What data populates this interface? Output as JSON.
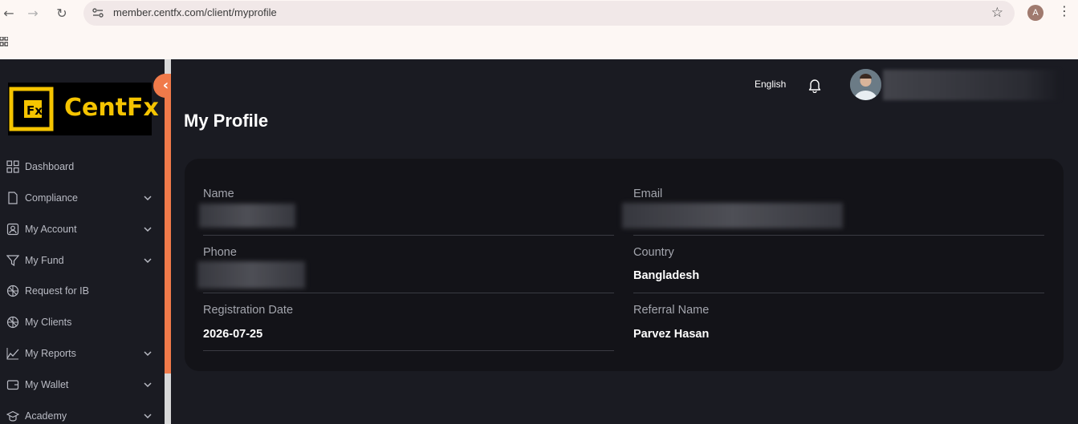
{
  "browser": {
    "url": "member.centfx.com/client/myprofile",
    "profile_initial": "A"
  },
  "sidebar": {
    "logo_text": "CentFx",
    "items": [
      {
        "label": "Dashboard",
        "icon": "dashboard-icon",
        "has_chevron": false
      },
      {
        "label": "Compliance",
        "icon": "document-icon",
        "has_chevron": true
      },
      {
        "label": "My Account",
        "icon": "account-icon",
        "has_chevron": true
      },
      {
        "label": "My Fund",
        "icon": "fund-icon",
        "has_chevron": true
      },
      {
        "label": "Request for IB",
        "icon": "ib-icon",
        "has_chevron": false
      },
      {
        "label": "My Clients",
        "icon": "clients-icon",
        "has_chevron": false
      },
      {
        "label": "My Reports",
        "icon": "reports-icon",
        "has_chevron": true
      },
      {
        "label": "My Wallet",
        "icon": "wallet-icon",
        "has_chevron": true
      },
      {
        "label": "Academy",
        "icon": "academy-icon",
        "has_chevron": true
      }
    ]
  },
  "header": {
    "language": "English"
  },
  "page": {
    "title": "My Profile"
  },
  "profile": {
    "name_label": "Name",
    "email_label": "Email",
    "phone_label": "Phone",
    "country_label": "Country",
    "country_value": "Bangladesh",
    "registration_label": "Registration Date",
    "registration_value": "2026-07-25",
    "referral_label": "Referral Name",
    "referral_value": "Parvez Hasan"
  },
  "colors": {
    "accent": "#f07a4a",
    "background": "#1a1b22",
    "card": "#131318"
  }
}
